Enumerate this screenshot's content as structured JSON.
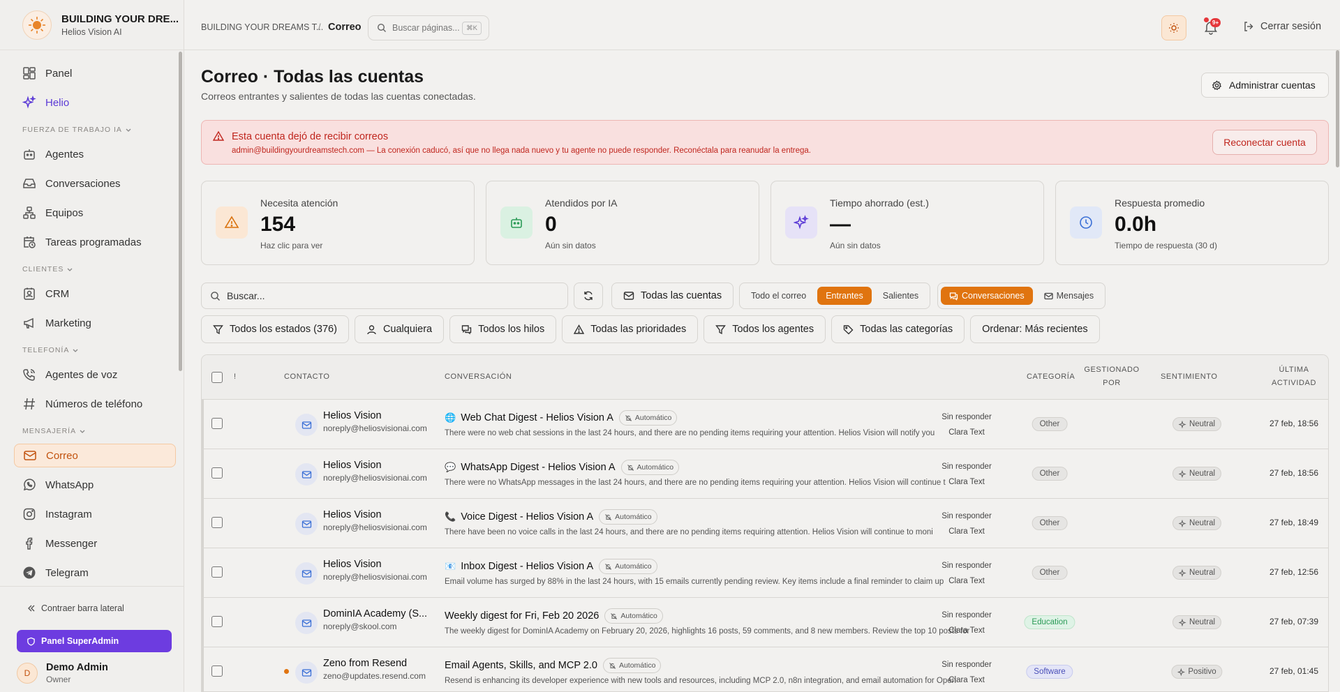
{
  "brand": {
    "name": "BUILDING YOUR DRE...",
    "sub": "Helios Vision AI"
  },
  "nav": {
    "panel": "Panel",
    "helio": "Helio",
    "section_ai": "FUERZA DE TRABAJO IA",
    "agents": "Agentes",
    "conversations": "Conversaciones",
    "teams": "Equipos",
    "scheduled": "Tareas programadas",
    "section_clients": "CLIENTES",
    "crm": "CRM",
    "marketing": "Marketing",
    "section_phone": "TELEFONÍA",
    "voice_agents": "Agentes de voz",
    "phone_numbers": "Números de teléfono",
    "section_msg": "MENSAJERÍA",
    "mail": "Correo",
    "whatsapp": "WhatsApp",
    "instagram": "Instagram",
    "messenger": "Messenger",
    "telegram": "Telegram"
  },
  "sidebar_bottom": {
    "collapse": "Contraer barra lateral",
    "superadmin": "Panel SuperAdmin",
    "avatar": "D",
    "user_name": "Demo Admin",
    "user_role": "Owner"
  },
  "topbar": {
    "breadcrumb_root": "BUILDING YOUR DREAMS T...",
    "breadcrumb_sep": "/",
    "breadcrumb_current": "Correo",
    "search_placeholder": "Buscar páginas...",
    "search_kbd": "⌘K",
    "notif_count": "9+",
    "logout": "Cerrar sesión"
  },
  "page": {
    "title": "Correo · Todas las cuentas",
    "subtitle": "Correos entrantes y salientes de todas las cuentas conectadas.",
    "manage_accounts": "Administrar cuentas"
  },
  "alert": {
    "title": "Esta cuenta dejó de recibir correos",
    "description": "admin@buildingyourdreamstech.com — La conexión caducó, así que no llega nada nuevo y tu agente no puede responder. Reconéctala para reanudar la entrega.",
    "button": "Reconectar cuenta"
  },
  "stats": [
    {
      "label": "Necesita atención",
      "value": "154",
      "hint": "Haz clic para ver"
    },
    {
      "label": "Atendidos por IA",
      "value": "0",
      "hint": "Aún sin datos"
    },
    {
      "label": "Tiempo ahorrado (est.)",
      "value": "—",
      "hint": "Aún sin datos"
    },
    {
      "label": "Respuesta promedio",
      "value": "0.0h",
      "hint": "Tiempo de respuesta (30 d)"
    }
  ],
  "filters": {
    "search_placeholder": "Buscar...",
    "accounts": "Todas las cuentas",
    "all_mail": "Todo el correo",
    "incoming": "Entrantes",
    "outgoing": "Salientes",
    "conversations": "Conversaciones",
    "messages": "Mensajes",
    "status": "Todos los estados (376)",
    "anyone": "Cualquiera",
    "threads": "Todos los hilos",
    "priorities": "Todas las prioridades",
    "agents": "Todos los agentes",
    "categories": "Todas las categorías",
    "sort": "Ordenar: Más recientes"
  },
  "table": {
    "headers": {
      "priority": "!",
      "contact": "CONTACTO",
      "conversation": "CONVERSACIÓN",
      "category": "CATEGORÍA",
      "handled_1": "GESTIONADO",
      "handled_2": "POR",
      "sentiment": "SENTIMIENTO",
      "activity_1": "ÚLTIMA",
      "activity_2": "ACTIVIDAD"
    },
    "auto_label": "Automático",
    "rows": [
      {
        "name": "Helios Vision",
        "email": "noreply@heliosvisionai.com",
        "emoji": "🌐",
        "subject": "Web Chat Digest - Helios Vision A",
        "preview": "There were no web chat sessions in the last 24 hours, and there are no pending items requiring your attention. Helios Vision will notify you",
        "category": "Other",
        "handled": "Sin responder",
        "agent": "Clara Text",
        "sentiment": "Neutral",
        "time": "27 feb, 18:56"
      },
      {
        "name": "Helios Vision",
        "email": "noreply@heliosvisionai.com",
        "emoji": "💬",
        "subject": "WhatsApp Digest - Helios Vision A",
        "preview": "There were no WhatsApp messages in the last 24 hours, and there are no pending items requiring your attention. Helios Vision will continue t",
        "category": "Other",
        "handled": "Sin responder",
        "agent": "Clara Text",
        "sentiment": "Neutral",
        "time": "27 feb, 18:56"
      },
      {
        "name": "Helios Vision",
        "email": "noreply@heliosvisionai.com",
        "emoji": "📞",
        "subject": "Voice Digest - Helios Vision A",
        "preview": "There have been no voice calls in the last 24 hours, and there are no pending items requiring attention. Helios Vision will continue to moni",
        "category": "Other",
        "handled": "Sin responder",
        "agent": "Clara Text",
        "sentiment": "Neutral",
        "time": "27 feb, 18:49"
      },
      {
        "name": "Helios Vision",
        "email": "noreply@heliosvisionai.com",
        "emoji": "📧",
        "subject": "Inbox Digest - Helios Vision A",
        "preview": "Email volume has surged by 88% in the last 24 hours, with 15 emails currently pending review. Key items include a final reminder to claim up",
        "category": "Other",
        "handled": "Sin responder",
        "agent": "Clara Text",
        "sentiment": "Neutral",
        "time": "27 feb, 12:56"
      },
      {
        "name": "DominIA Academy (S...",
        "email": "noreply@skool.com",
        "emoji": "",
        "subject": "Weekly digest for Fri, Feb 20 2026",
        "preview": "The weekly digest for DominIA Academy on February 20, 2026, highlights 16 posts, 59 comments, and 8 new members. Review the top 10 posts for",
        "category": "Education",
        "handled": "Sin responder",
        "agent": "Clara Text",
        "sentiment": "Neutral",
        "time": "27 feb, 07:39"
      },
      {
        "name": "Zeno from Resend",
        "email": "zeno@updates.resend.com",
        "emoji": "",
        "subject": "Email Agents, Skills, and MCP 2.0",
        "preview": "Resend is enhancing its developer experience with new tools and resources, including MCP 2.0, n8n integration, and email automation for Open",
        "category": "Software",
        "handled": "Sin responder",
        "agent": "Clara Text",
        "sentiment": "Positivo",
        "time": "27 feb, 01:45",
        "unread": true
      }
    ]
  },
  "colors": {
    "accent": "#e0740f",
    "helio": "#5b3ad6",
    "danger": "#c0261e",
    "superadmin": "#6d3ce0"
  }
}
